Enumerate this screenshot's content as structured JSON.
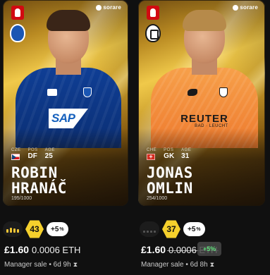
{
  "cards": [
    {
      "first_name": "ROBIN",
      "last_name": "HRANÁČ",
      "country_label": "CZE",
      "pos_label": "POS",
      "pos": "DF",
      "age_label": "AGE",
      "age": "25",
      "serial": "195/1000",
      "brand": "sorare",
      "sponsor": "SAP",
      "form_icon": "form-bars-icon",
      "score": "43",
      "bonus": "+5",
      "bonus_unit": "%",
      "price": "£1.60",
      "eth": "0.0006 ETH",
      "sale_text": "Manager sale • 6d 9h",
      "hourglass": "⧗"
    },
    {
      "first_name": "JONAS",
      "last_name": "OMLIN",
      "country_label": "CHE",
      "pos_label": "POS",
      "pos": "GK",
      "age_label": "AGE",
      "age": "31",
      "serial": "254/1000",
      "brand": "sorare",
      "sponsor": "REUTER",
      "sponsor_sub": "BAD · LEUCHT",
      "form_icon": "form-dots-icon",
      "score": "37",
      "bonus": "+5",
      "bonus_unit": "%",
      "price": "£1.60",
      "eth": "0.0006 ETH",
      "sale_text": "Manager sale • 6d 8h",
      "hourglass": "⧗"
    }
  ],
  "tooltip": "+5%",
  "colors": {
    "score": "#f5d02c",
    "tooltip_text": "#5fe07a",
    "bg": "#101010"
  }
}
